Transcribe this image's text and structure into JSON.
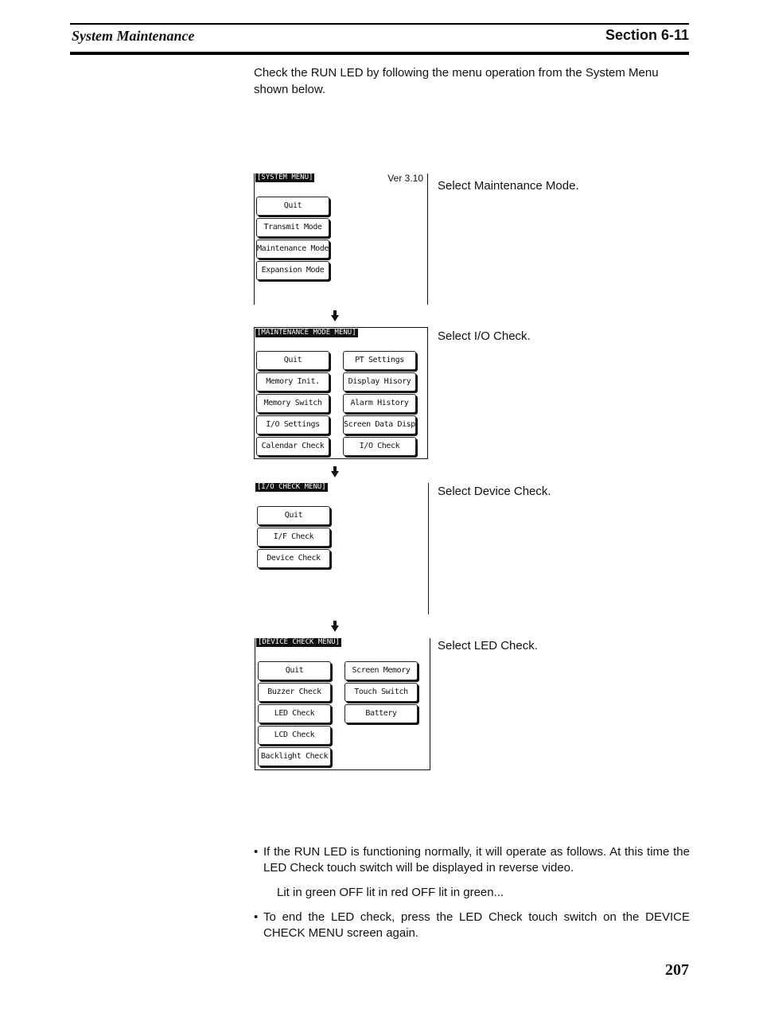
{
  "header": {
    "chapter_title": "System Maintenance",
    "section": "Section  6-11"
  },
  "intro_text": "Check the RUN LED by following the menu operation from the System Menu shown below.",
  "screens": [
    {
      "title": "[SYSTEM MENU]",
      "version": "Ver 3.10",
      "caption": "Select Maintenance Mode.",
      "left_buttons": [
        "Quit",
        "Transmit Mode",
        "Maintenance Mode",
        "Expansion Mode"
      ],
      "right_buttons": []
    },
    {
      "title": "[MAINTENANCE MODE MENU]",
      "caption": "Select I/O Check.",
      "left_buttons": [
        "Quit",
        "Memory Init.",
        "Memory Switch",
        "I/O Settings",
        "Calendar Check"
      ],
      "right_buttons": [
        "PT Settings",
        "Display Hisory",
        "Alarm History",
        "Screen Data Disp.",
        "I/O Check"
      ]
    },
    {
      "title": "[I/O CHECK MENU]",
      "caption": "Select Device Check.",
      "left_buttons": [
        "Quit",
        "I/F Check",
        "Device Check"
      ],
      "right_buttons": []
    },
    {
      "title": "[DEVICE CHECK MENU]",
      "caption": "Select LED Check.",
      "left_buttons": [
        "Quit",
        "Buzzer Check",
        "LED Check",
        "LCD Check",
        "Backlight Check"
      ],
      "right_buttons": [
        "Screen Memory",
        "Touch Switch",
        "Battery"
      ]
    }
  ],
  "arrow_icon": "down-arrow-icon",
  "bullets": [
    "If the RUN LED is functioning normally, it will operate as follows. At this time the LED Check touch switch will be displayed in reverse video.",
    "To end the LED check, press the LED Check touch switch on the DEVICE CHECK MENU screen again."
  ],
  "led_sequence": "Lit in green  OFF  lit in red  OFF  lit in green...",
  "page_number": "207"
}
